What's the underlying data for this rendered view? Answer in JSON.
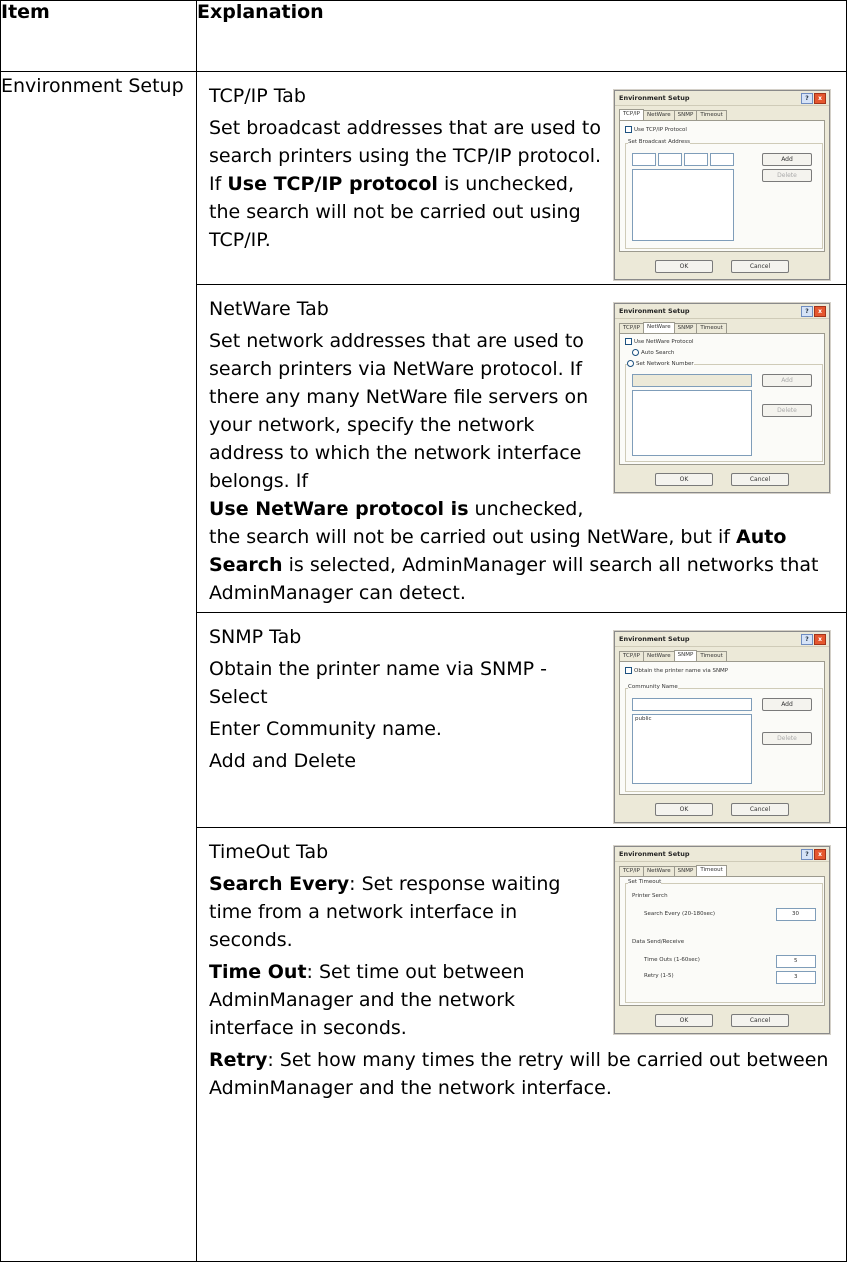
{
  "header": {
    "item": "Item",
    "explanation": "Explanation"
  },
  "row": {
    "item": "Environment Setup"
  },
  "tcp": {
    "title": "TCP/IP Tab",
    "text1": "Set broadcast addresses that are used to search printers using the TCP/IP protocol. If ",
    "bold1": "Use TCP/IP protocol",
    "text2": " is unchecked, the search will not be carried out using TCP/IP.",
    "dialog": {
      "title": "Environment Setup",
      "help": "?",
      "close": "x",
      "tabs": [
        "TCP/IP",
        "NetWare",
        "SNMP",
        "Timeout"
      ],
      "check_label": "Use TCP/IP Protocol",
      "group_label": "Set Broadcast Address",
      "add": "Add",
      "delete": "Delete",
      "ok": "OK",
      "cancel": "Cancel"
    }
  },
  "netware": {
    "title": "NetWare Tab",
    "text1": "Set network addresses that are used to search printers via NetWare protocol. If there any many NetWare file servers on your network, specify the network address to which the network interface belongs. If",
    "bold1": "Use NetWare protocol is",
    "text2": " unchecked, the search will not be carried out using NetWare, but if ",
    "bold2": "Auto Search",
    "text3": " is selected, AdminManager will search all networks that AdminManager can detect.",
    "dialog": {
      "title": "Environment Setup",
      "help": "?",
      "close": "x",
      "tabs": [
        "TCP/IP",
        "NetWare",
        "SNMP",
        "Timeout"
      ],
      "check_label": "Use NetWare Protocol",
      "radio1": "Auto Search",
      "radio2": "Set Network Number",
      "add": "Add",
      "delete": "Delete",
      "ok": "OK",
      "cancel": "Cancel"
    }
  },
  "snmp": {
    "title": "SNMP Tab",
    "line1": "Obtain the printer name via SNMP - Select",
    "line2": "Enter Community name.",
    "line3": "Add and Delete",
    "dialog": {
      "title": "Environment Setup",
      "help": "?",
      "close": "x",
      "tabs": [
        "TCP/IP",
        "NetWare",
        "SNMP",
        "Timeout"
      ],
      "check_label": "Obtain the printer name via SNMP",
      "group_label": "Community Name",
      "list_item": "public",
      "add": "Add",
      "delete": "Delete",
      "ok": "OK",
      "cancel": "Cancel"
    }
  },
  "timeout": {
    "title": "TimeOut Tab",
    "bold1": "Search Every",
    "text1": ": Set response waiting time from a network interface in seconds.",
    "bold2": "Time Out",
    "text2": ": Set time out between AdminManager and the network interface in seconds.",
    "bold3": "Retry",
    "text3": ": Set how many times the retry will be carried out between AdminManager and the network interface.",
    "dialog": {
      "title": "Environment Setup",
      "help": "?",
      "close": "x",
      "tabs": [
        "TCP/IP",
        "NetWare",
        "SNMP",
        "Timeout"
      ],
      "set_timeout": "Set Timeout",
      "printer_search": "Printer Serch",
      "search_every": "Search Every (20-180sec)",
      "search_value": "30",
      "data_send": "Data Send/Receive",
      "time_outs": "Time Outs (1-60sec)",
      "time_value": "5",
      "retry": "Retry (1-5)",
      "retry_value": "3",
      "ok": "OK",
      "cancel": "Cancel"
    }
  }
}
